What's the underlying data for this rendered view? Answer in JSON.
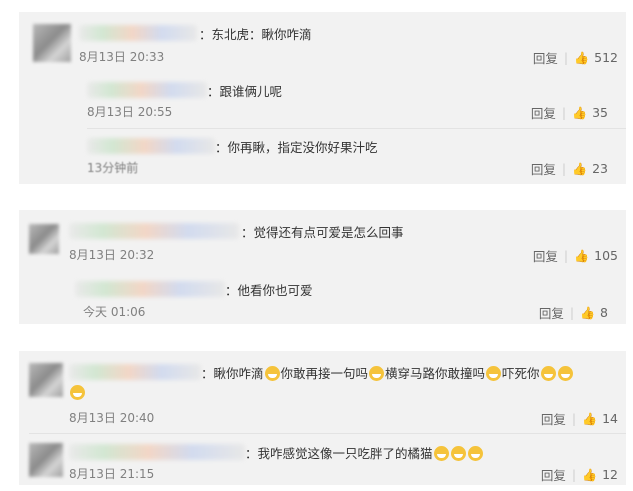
{
  "comments": [
    {
      "text": "：东北虎：瞅你咋滴",
      "time": "8月13日 20:33",
      "reply": "回复",
      "likes": "512",
      "replies": [
        {
          "text": "：跟谁俩儿呢",
          "time": "8月13日 20:55",
          "reply": "回复",
          "likes": "35"
        },
        {
          "text": "：你再瞅，指定没你好果汁吃",
          "time": "13分钟前",
          "reply": "回复",
          "likes": "23"
        }
      ]
    },
    {
      "text": "：觉得还有点可爱是怎么回事",
      "time": "8月13日 20:32",
      "reply": "回复",
      "likes": "105",
      "replies": [
        {
          "text": "：他看你也可爱",
          "time": "今天 01:06",
          "reply": "回复",
          "likes": "8"
        }
      ]
    },
    {
      "text": "：瞅你咋滴",
      "text2": "你敢再接一句吗",
      "text3": "横穿马路你敢撞吗",
      "text4": "吓死你",
      "time": "8月13日 20:40",
      "reply": "回复",
      "likes": "14",
      "replies": []
    },
    {
      "text": "：我咋感觉这像一只吃胖了的橘猫",
      "time": "8月13日 21:15",
      "reply": "回复",
      "likes": "12",
      "replies": []
    }
  ],
  "icons": {
    "like": "thumbs-up-icon",
    "emoji": "grin-emoji-icon"
  }
}
